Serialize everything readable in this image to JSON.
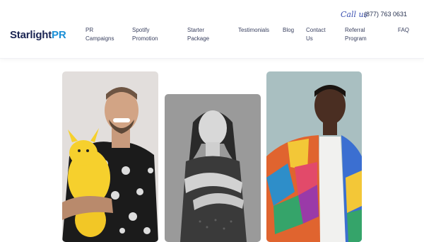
{
  "header": {
    "logo": {
      "word": "Starlight",
      "accent": "PR"
    },
    "call_us": "Call us",
    "phone": "(877) 763 0631",
    "nav": [
      {
        "label": "PR\nCampaigns"
      },
      {
        "label": "Spotify\nPromotion"
      },
      {
        "label": "Starter\nPackage"
      },
      {
        "label": "Testimonials"
      },
      {
        "label": "Blog"
      },
      {
        "label": "Contact\nUs"
      },
      {
        "label": "Referral\nProgram"
      },
      {
        "label": "FAQ"
      }
    ]
  },
  "artists": [
    {
      "bg": "#e2dedc"
    },
    {
      "bg": "#9a9a9a"
    },
    {
      "bg": "#a9bfc1"
    }
  ],
  "colors": {
    "navy": "#1a2452",
    "accent_blue": "#1b8fd6",
    "script_blue": "#3a4fb0"
  }
}
